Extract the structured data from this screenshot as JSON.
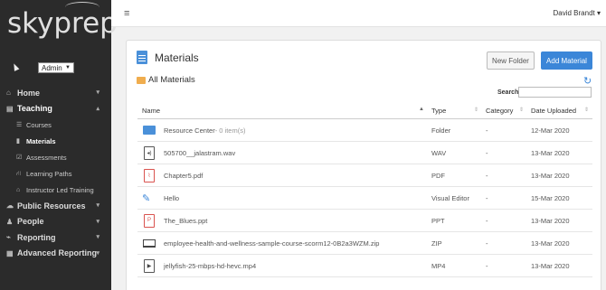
{
  "brand": {
    "logo_text": "skyprep"
  },
  "sidebar": {
    "role": "Admin",
    "items": [
      {
        "label": "Home",
        "icon": "home-icon",
        "glyph": "⌂",
        "chevron": "▾"
      },
      {
        "label": "Teaching",
        "icon": "book-icon",
        "glyph": "▤",
        "chevron": "▴"
      },
      {
        "label": "Public Resources",
        "icon": "cloud-icon",
        "glyph": "☁",
        "chevron": "▾"
      },
      {
        "label": "People",
        "icon": "person-icon",
        "glyph": "♟",
        "chevron": "▾"
      },
      {
        "label": "Reporting",
        "icon": "line-chart-icon",
        "glyph": "⌁",
        "chevron": "▾"
      },
      {
        "label": "Advanced Reporting",
        "icon": "area-chart-icon",
        "glyph": "▦",
        "chevron": "▾"
      }
    ],
    "sub_items": [
      {
        "label": "Courses",
        "icon": "list-icon",
        "glyph": "☰"
      },
      {
        "label": "Materials",
        "icon": "document-icon",
        "glyph": "▮"
      },
      {
        "label": "Assessments",
        "icon": "checkbox-icon",
        "glyph": "☑"
      },
      {
        "label": "Learning Paths",
        "icon": "road-icon",
        "glyph": "⛙"
      },
      {
        "label": "Instructor Led Training",
        "icon": "graduation-cap-icon",
        "glyph": "⌂"
      }
    ]
  },
  "topbar": {
    "menu_glyph": "≡",
    "user_name": "David Brandt",
    "user_caret": "▾"
  },
  "panel": {
    "title": "Materials",
    "new_folder": "New Folder",
    "add_material": "Add Material",
    "folder_title": "All Materials",
    "refresh_glyph": "↻",
    "search_label": "Search:",
    "search_value": ""
  },
  "table": {
    "headers": {
      "name": "Name",
      "type": "Type",
      "category": "Category",
      "date": "Date Uploaded"
    },
    "sort_glyphs": {
      "asc": "▲",
      "both": "⇕"
    },
    "rows": [
      {
        "name": "Resource Center",
        "sub": " - 0 item(s)",
        "type": "Folder",
        "category": "-",
        "date": "12-Mar 2020",
        "icon": "folder-icon",
        "glyph": ""
      },
      {
        "name": "505700__jalastram.wav",
        "sub": "",
        "type": "WAV",
        "category": "-",
        "date": "13-Mar 2020",
        "icon": "audio-file-icon",
        "glyph": "◂)"
      },
      {
        "name": "Chapter5.pdf",
        "sub": "",
        "type": "PDF",
        "category": "-",
        "date": "13-Mar 2020",
        "icon": "pdf-file-icon",
        "glyph": "⌇"
      },
      {
        "name": "Hello",
        "sub": "",
        "type": "Visual Editor",
        "category": "-",
        "date": "15-Mar 2020",
        "icon": "magic-wand-icon",
        "glyph": "✎"
      },
      {
        "name": "The_Blues.ppt",
        "sub": "",
        "type": "PPT",
        "category": "-",
        "date": "13-Mar 2020",
        "icon": "powerpoint-file-icon",
        "glyph": "P"
      },
      {
        "name": "employee-health-and-wellness-sample-course-scorm12-0B2a3WZM.zip",
        "sub": "",
        "type": "ZIP",
        "category": "-",
        "date": "13-Mar 2020",
        "icon": "laptop-icon",
        "glyph": ""
      },
      {
        "name": "jellyfish-25-mbps-hd-hevc.mp4",
        "sub": "",
        "type": "MP4",
        "category": "-",
        "date": "13-Mar 2020",
        "icon": "video-file-icon",
        "glyph": "▶"
      }
    ]
  }
}
